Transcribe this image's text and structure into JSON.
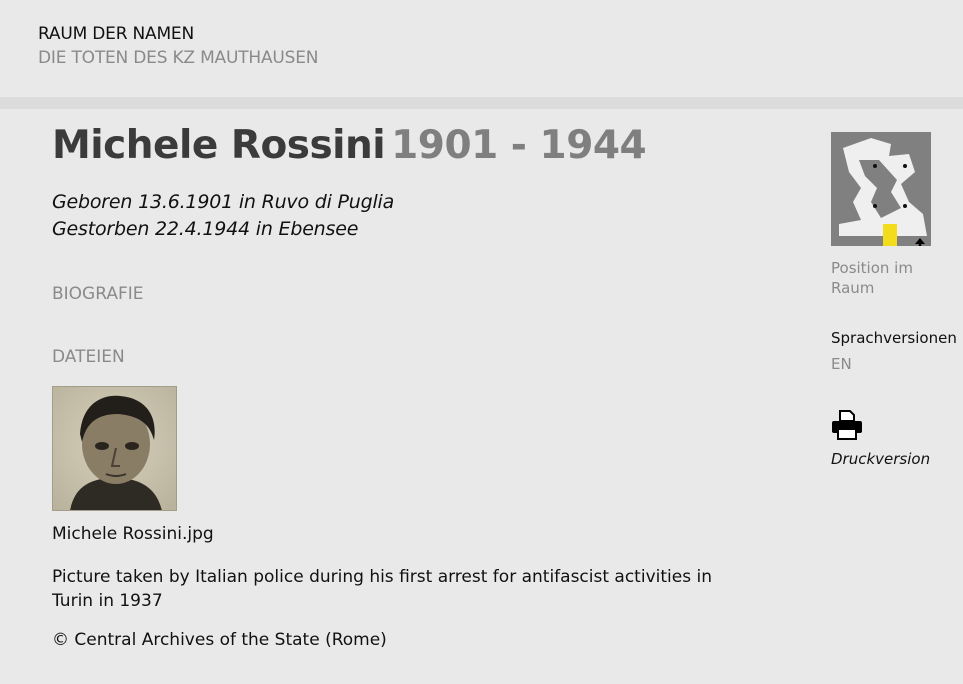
{
  "header": {
    "title": "RAUM DER NAMEN",
    "subtitle": "DIE TOTEN DES KZ MAUTHAUSEN"
  },
  "person": {
    "name": "Michele Rossini",
    "years": "1901 - 1944",
    "born": "Geboren 13.6.1901 in Ruvo di Puglia",
    "died": "Gestorben 22.4.1944 in Ebensee"
  },
  "sections": {
    "biography": "BIOGRAFIE",
    "files": "DATEIEN"
  },
  "file": {
    "name": "Michele Rossini.jpg",
    "caption": "Picture taken by Italian police during his first arrest for antifascist activities in Turin in 1937",
    "credit": "© Central Archives of the State (Rome)"
  },
  "sidebar": {
    "position_label": "Position im Raum",
    "languages_heading": "Sprachversionen",
    "language_en": "EN",
    "print_label": "Druckversion"
  },
  "colors": {
    "background": "#e9e9e9",
    "divider": "#dcdcdc",
    "muted_text": "#8a8a8a",
    "map_background": "#808080",
    "map_highlight": "#f2dc1c"
  },
  "icons": {
    "room_map": "room-map-icon",
    "print": "printer-icon",
    "position_arrow": "arrow-up-icon"
  }
}
